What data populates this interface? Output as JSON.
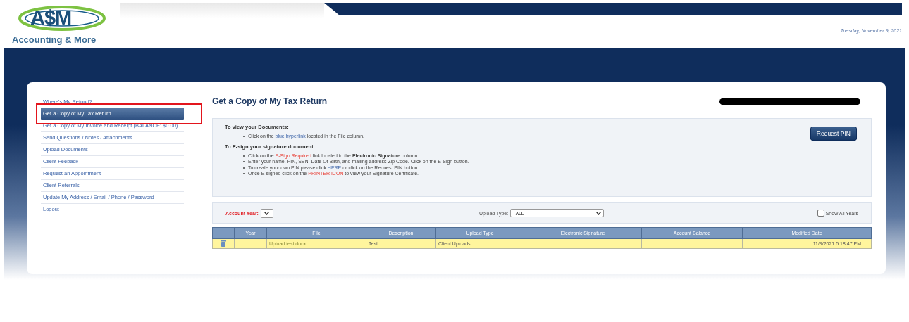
{
  "header": {
    "logo_mark": "A$M",
    "logo_name": "Accounting & More",
    "date": "Tuesday, November 9, 2021"
  },
  "sidebar": {
    "items": [
      {
        "label": "Where's My Refund?",
        "selected": false
      },
      {
        "label": "Get a Copy of My Tax Return",
        "selected": true
      },
      {
        "label": "Get a Copy of My Invoice and Receipt (BALANCE: $0.00)",
        "selected": false
      },
      {
        "label": "Send Questions / Notes / Attachments",
        "selected": false
      },
      {
        "label": "Upload Documents",
        "selected": false
      },
      {
        "label": "Client Feeback",
        "selected": false
      },
      {
        "label": "Request an Appointment",
        "selected": false
      },
      {
        "label": "Client Referrals",
        "selected": false
      },
      {
        "label": "Update My Address / Email / Phone / Password",
        "selected": false
      },
      {
        "label": "Logout",
        "selected": false
      }
    ]
  },
  "page_title": "Get a Copy of My Tax Return",
  "instructions": {
    "button": "Request PIN",
    "sections": [
      {
        "heading": "To view your Documents:",
        "bullets": [
          [
            {
              "kind": "plain",
              "text": "Click on the "
            },
            {
              "kind": "link",
              "text": "blue hyperlink"
            },
            {
              "kind": "plain",
              "text": " located in the File column."
            }
          ]
        ]
      },
      {
        "heading": "To E-sign your signature document:",
        "bullets": [
          [
            {
              "kind": "plain",
              "text": "Click on the "
            },
            {
              "kind": "alert",
              "text": "E-Sign Required"
            },
            {
              "kind": "plain",
              "text": " link located in the "
            },
            {
              "kind": "bold",
              "text": "Electronic Signature"
            },
            {
              "kind": "plain",
              "text": " column."
            }
          ],
          [
            {
              "kind": "plain",
              "text": "Enter your name, PIN, SSN, Date Of Birth, and mailing address Zip Code. Click on the E-Sign button."
            }
          ],
          [
            {
              "kind": "plain",
              "text": "To create your own PIN please click "
            },
            {
              "kind": "link",
              "text": "HERE"
            },
            {
              "kind": "plain",
              "text": " or click on the Request PIN button."
            }
          ],
          [
            {
              "kind": "plain",
              "text": "Once E-signed click on the "
            },
            {
              "kind": "alert",
              "text": "PRINTER ICON"
            },
            {
              "kind": "plain",
              "text": " to view your Signature Certificate."
            }
          ]
        ]
      }
    ]
  },
  "filters": {
    "account_year_label": "Account Year:",
    "upload_type_label": "Upload Type:",
    "upload_type_value": "- ALL -",
    "show_all_years": {
      "label": "Show All Years",
      "checked": false
    }
  },
  "table": {
    "columns": [
      "",
      "Year",
      "File",
      "Description",
      "Upload Type",
      "Electronic Signature",
      "Account Balance",
      "Modified Date"
    ],
    "rows": [
      {
        "year": "",
        "file": "Upload test.docx",
        "description": "Test",
        "upload_type": "Client Uploads",
        "electronic_signature": "",
        "account_balance": "",
        "modified_date": "11/9/2021 5:18:47 PM"
      }
    ]
  }
}
